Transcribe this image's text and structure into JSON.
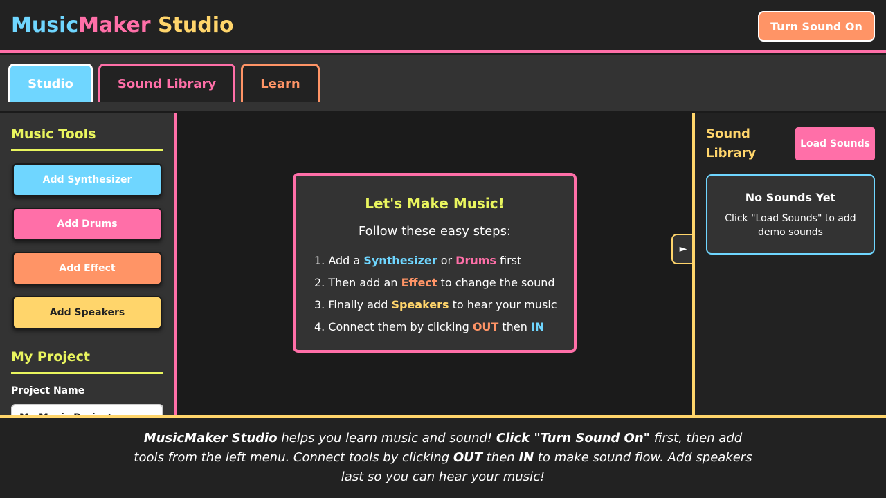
{
  "app": {
    "title_part1": "Music",
    "title_part2": "Maker",
    "title_part3": " Studio",
    "sound_button": "Turn Sound On"
  },
  "tabs": [
    {
      "label": "Studio",
      "active": true
    },
    {
      "label": "Sound Library",
      "active": false
    },
    {
      "label": "Learn",
      "active": false
    }
  ],
  "tools_panel": {
    "title": "Music Tools",
    "buttons": [
      {
        "label": "Add Synthesizer",
        "color": "#6fd6ff"
      },
      {
        "label": "Add Drums",
        "color": "#ff6fa8"
      },
      {
        "label": "Add Effect",
        "color": "#ff9466"
      },
      {
        "label": "Add Speakers",
        "color": "#ffd56b"
      }
    ],
    "project_title": "My Project",
    "project_name_label": "Project Name",
    "project_name_value": "My Music Project"
  },
  "welcome": {
    "title": "Let's Make Music!",
    "subtitle": "Follow these easy steps:",
    "steps": [
      {
        "n": "1.",
        "pre": "Add a ",
        "k1": "Synthesizer",
        "mid": " or ",
        "k2": "Drums",
        "post": " first"
      },
      {
        "n": "2.",
        "pre": "Then add an ",
        "k1": "Effect",
        "post": " to change the sound"
      },
      {
        "n": "3.",
        "pre": "Finally add ",
        "k1": "Speakers",
        "post": " to hear your music"
      },
      {
        "n": "4.",
        "pre": "Connect them by clicking ",
        "k1": "OUT",
        "mid": " then ",
        "k2": "IN"
      }
    ]
  },
  "panel_toggle": "►",
  "library": {
    "title": "Sound Library",
    "load_button": "Load Sounds",
    "empty_title": "No Sounds Yet",
    "empty_text": "Click \"Load Sounds\" to add demo sounds"
  },
  "footer": {
    "b1": "MusicMaker Studio",
    "t1": " helps you learn music and sound! ",
    "b2": "Click \"Turn Sound On\"",
    "t2": " first, then add tools from the left menu. Connect tools by clicking ",
    "b3": "OUT",
    "t3": " then ",
    "b4": "IN",
    "t4": " to make sound flow. Add speakers last so you can hear your music!"
  },
  "colors": {
    "blue": "#6fd6ff",
    "pink": "#ff6fa8",
    "orange": "#ff9466",
    "yellow": "#ffd56b",
    "lime": "#e9f55e"
  }
}
